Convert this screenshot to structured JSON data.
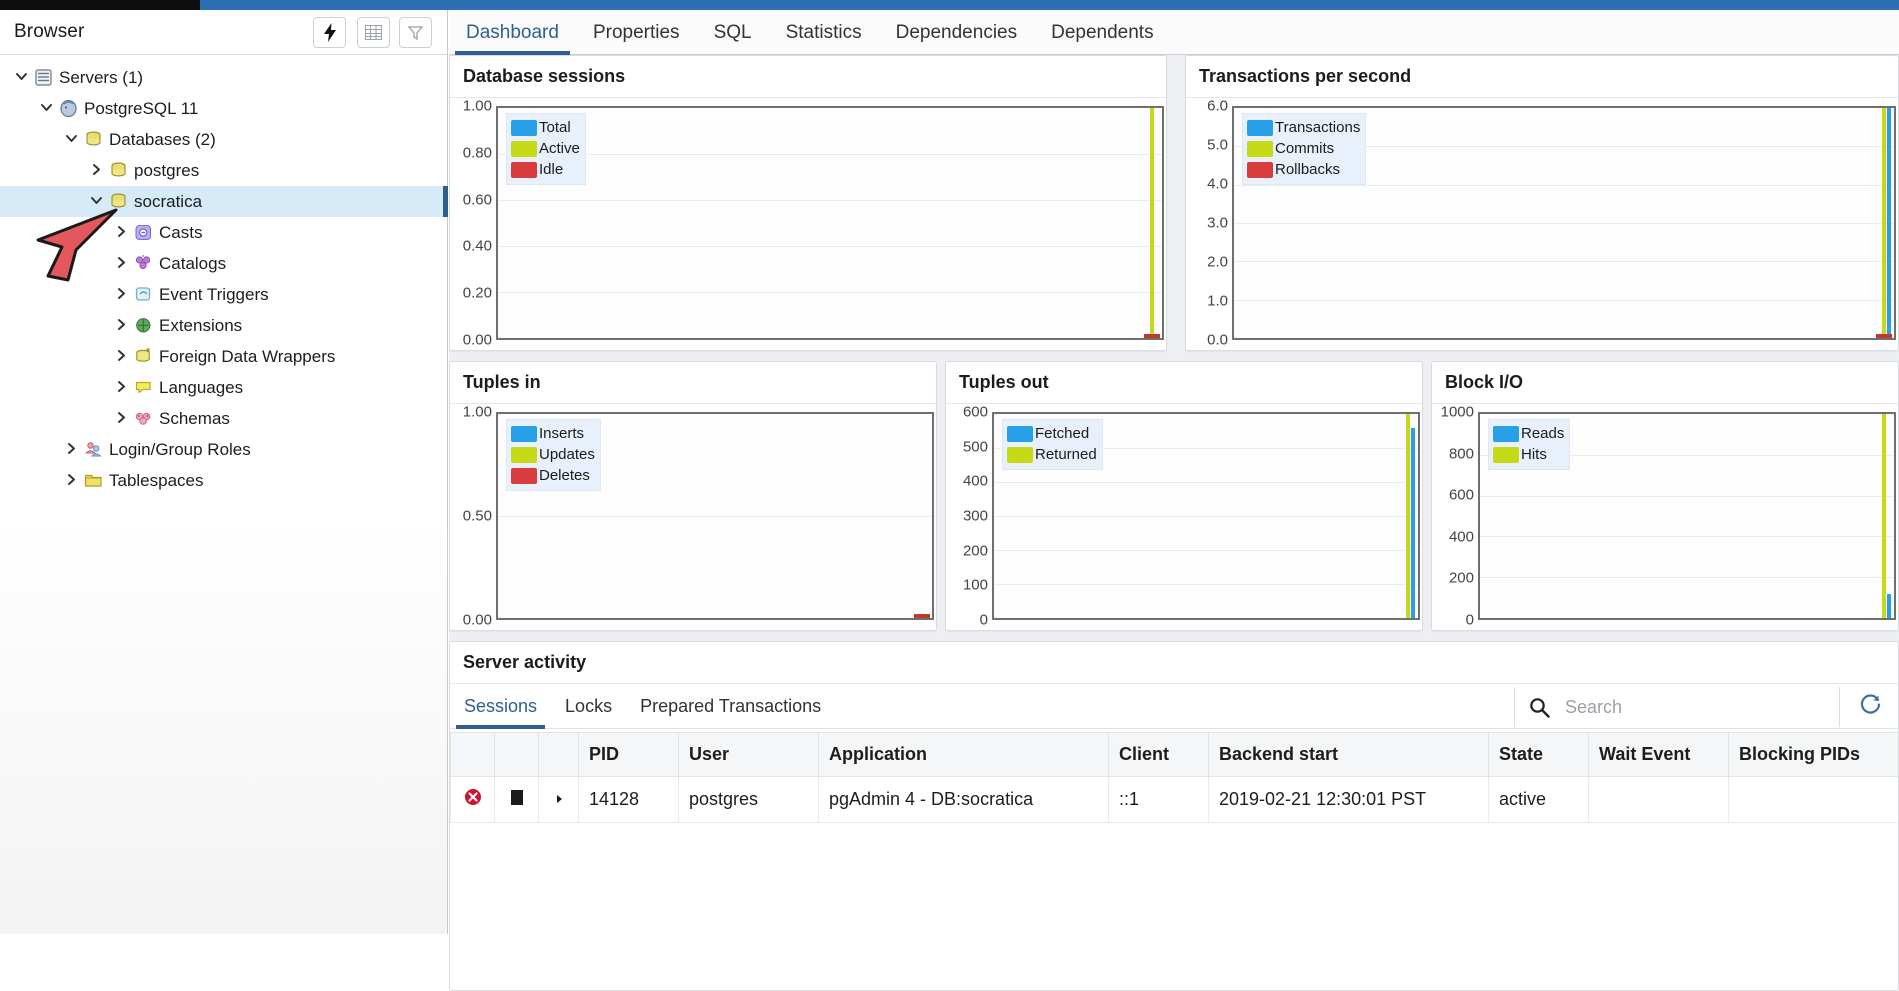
{
  "window": {
    "close_label": "✕"
  },
  "browser": {
    "title": "Browser",
    "toolbar": [
      {
        "name": "query-tool-button",
        "icon": "lightning-bolt-icon"
      },
      {
        "name": "view-data-button",
        "icon": "table-grid-icon"
      },
      {
        "name": "filter-button",
        "icon": "funnel-filter-icon"
      }
    ],
    "tree": [
      {
        "label": "Servers (1)",
        "icon": "servers-icon",
        "indent": 0,
        "state": "open",
        "selected": false
      },
      {
        "label": "PostgreSQL 11",
        "icon": "postgres-icon",
        "indent": 1,
        "state": "open",
        "selected": false
      },
      {
        "label": "Databases (2)",
        "icon": "databases-icon",
        "indent": 2,
        "state": "open",
        "selected": false
      },
      {
        "label": "postgres",
        "icon": "database-icon",
        "indent": 3,
        "state": "closed",
        "selected": false
      },
      {
        "label": "socratica",
        "icon": "database-icon",
        "indent": 3,
        "state": "open",
        "selected": true
      },
      {
        "label": "Casts",
        "icon": "casts-icon",
        "indent": 4,
        "state": "closed",
        "selected": false
      },
      {
        "label": "Catalogs",
        "icon": "catalogs-icon",
        "indent": 4,
        "state": "closed",
        "selected": false
      },
      {
        "label": "Event Triggers",
        "icon": "event-triggers-icon",
        "indent": 4,
        "state": "closed",
        "selected": false
      },
      {
        "label": "Extensions",
        "icon": "extensions-icon",
        "indent": 4,
        "state": "closed",
        "selected": false
      },
      {
        "label": "Foreign Data Wrappers",
        "icon": "foreign-data-wrappers-icon",
        "indent": 4,
        "state": "closed",
        "selected": false
      },
      {
        "label": "Languages",
        "icon": "languages-icon",
        "indent": 4,
        "state": "closed",
        "selected": false
      },
      {
        "label": "Schemas",
        "icon": "schemas-icon",
        "indent": 4,
        "state": "closed",
        "selected": false
      },
      {
        "label": "Login/Group Roles",
        "icon": "roles-icon",
        "indent": 2,
        "state": "closed",
        "selected": false
      },
      {
        "label": "Tablespaces",
        "icon": "tablespaces-icon",
        "indent": 2,
        "state": "closed",
        "selected": false
      }
    ]
  },
  "main": {
    "tabs": [
      {
        "label": "Dashboard",
        "active": true
      },
      {
        "label": "Properties",
        "active": false
      },
      {
        "label": "SQL",
        "active": false
      },
      {
        "label": "Statistics",
        "active": false
      },
      {
        "label": "Dependencies",
        "active": false
      },
      {
        "label": "Dependents",
        "active": false
      }
    ]
  },
  "colors": {
    "series_blue": "#28a0e8",
    "series_green": "#c6d916",
    "series_red": "#d83c3c",
    "accent": "#2e5f92",
    "selection": "#d6eaf8"
  },
  "chart_data": [
    {
      "id": "database-sessions",
      "type": "line",
      "title": "Database sessions",
      "xlabel": "",
      "ylabel": "",
      "ylim": [
        0,
        1
      ],
      "yticks": [
        "1.00",
        "0.80",
        "0.60",
        "0.40",
        "0.20",
        "0.00"
      ],
      "grid": true,
      "legend_position": "top-left",
      "series": [
        {
          "name": "Total",
          "color": "#28a0e8",
          "values": [
            0,
            0,
            0,
            0,
            0,
            0,
            0,
            0,
            0,
            0
          ]
        },
        {
          "name": "Active",
          "color": "#c6d916",
          "values": [
            0,
            0,
            0,
            0,
            0,
            0,
            0,
            0,
            0,
            1
          ]
        },
        {
          "name": "Idle",
          "color": "#d83c3c",
          "values": [
            0,
            0,
            0,
            0,
            0,
            0,
            0,
            0,
            0,
            0
          ]
        }
      ]
    },
    {
      "id": "transactions-per-second",
      "type": "line",
      "title": "Transactions per second",
      "xlabel": "",
      "ylabel": "",
      "ylim": [
        0,
        6
      ],
      "yticks": [
        "6.0",
        "5.0",
        "4.0",
        "3.0",
        "2.0",
        "1.0",
        "0.0"
      ],
      "grid": true,
      "legend_position": "top-left",
      "series": [
        {
          "name": "Transactions",
          "color": "#28a0e8",
          "values": [
            0,
            0,
            0,
            0,
            0,
            0,
            0,
            0,
            0,
            6
          ]
        },
        {
          "name": "Commits",
          "color": "#c6d916",
          "values": [
            0,
            0,
            0,
            0,
            0,
            0,
            0,
            0,
            0,
            6
          ]
        },
        {
          "name": "Rollbacks",
          "color": "#d83c3c",
          "values": [
            0,
            0,
            0,
            0,
            0,
            0,
            0,
            0,
            0,
            0
          ]
        }
      ]
    },
    {
      "id": "tuples-in",
      "type": "line",
      "title": "Tuples in",
      "xlabel": "",
      "ylabel": "",
      "ylim": [
        0,
        1
      ],
      "yticks": [
        "1.00",
        "0.50",
        "0.00"
      ],
      "grid": true,
      "legend_position": "top-left",
      "series": [
        {
          "name": "Inserts",
          "color": "#28a0e8",
          "values": [
            0,
            0,
            0,
            0,
            0,
            0,
            0,
            0,
            0,
            0
          ]
        },
        {
          "name": "Updates",
          "color": "#c6d916",
          "values": [
            0,
            0,
            0,
            0,
            0,
            0,
            0,
            0,
            0,
            0
          ]
        },
        {
          "name": "Deletes",
          "color": "#d83c3c",
          "values": [
            0,
            0,
            0,
            0,
            0,
            0,
            0,
            0,
            0,
            0
          ]
        }
      ]
    },
    {
      "id": "tuples-out",
      "type": "line",
      "title": "Tuples out",
      "xlabel": "",
      "ylabel": "",
      "ylim": [
        0,
        600
      ],
      "yticks": [
        "600",
        "500",
        "400",
        "300",
        "200",
        "100",
        "0"
      ],
      "grid": true,
      "legend_position": "top-left",
      "series": [
        {
          "name": "Fetched",
          "color": "#28a0e8",
          "values": [
            0,
            0,
            0,
            0,
            0,
            0,
            0,
            0,
            0,
            560
          ]
        },
        {
          "name": "Returned",
          "color": "#c6d916",
          "values": [
            0,
            0,
            0,
            0,
            0,
            0,
            0,
            0,
            0,
            600
          ]
        }
      ]
    },
    {
      "id": "block-io",
      "type": "line",
      "title": "Block I/O",
      "xlabel": "",
      "ylabel": "",
      "ylim": [
        0,
        1000
      ],
      "yticks": [
        "1000",
        "800",
        "600",
        "400",
        "200",
        "0"
      ],
      "grid": true,
      "legend_position": "top-left",
      "series": [
        {
          "name": "Reads",
          "color": "#28a0e8",
          "values": [
            0,
            0,
            0,
            0,
            0,
            0,
            0,
            0,
            0,
            120
          ]
        },
        {
          "name": "Hits",
          "color": "#c6d916",
          "values": [
            0,
            0,
            0,
            0,
            0,
            0,
            0,
            0,
            0,
            1000
          ]
        }
      ]
    }
  ],
  "server_activity": {
    "title": "Server activity",
    "tabs": [
      {
        "label": "Sessions",
        "active": true
      },
      {
        "label": "Locks",
        "active": false
      },
      {
        "label": "Prepared Transactions",
        "active": false
      }
    ],
    "search": {
      "value": "",
      "placeholder": "Search"
    },
    "refresh_icon": "refresh-icon",
    "columns": [
      "",
      "",
      "",
      "PID",
      "User",
      "Application",
      "Client",
      "Backend start",
      "State",
      "Wait Event",
      "Blocking PIDs"
    ],
    "rows": [
      {
        "terminate_icon": "terminate-session-icon",
        "cancel_icon": "cancel-query-icon",
        "expand_icon": "expand-row-icon",
        "pid": "14128",
        "user": "postgres",
        "application": "pgAdmin 4 - DB:socratica",
        "client": "::1",
        "backend_start": "2019-02-21 12:30:01 PST",
        "state": "active",
        "wait_event": "",
        "blocking_pids": ""
      }
    ]
  }
}
